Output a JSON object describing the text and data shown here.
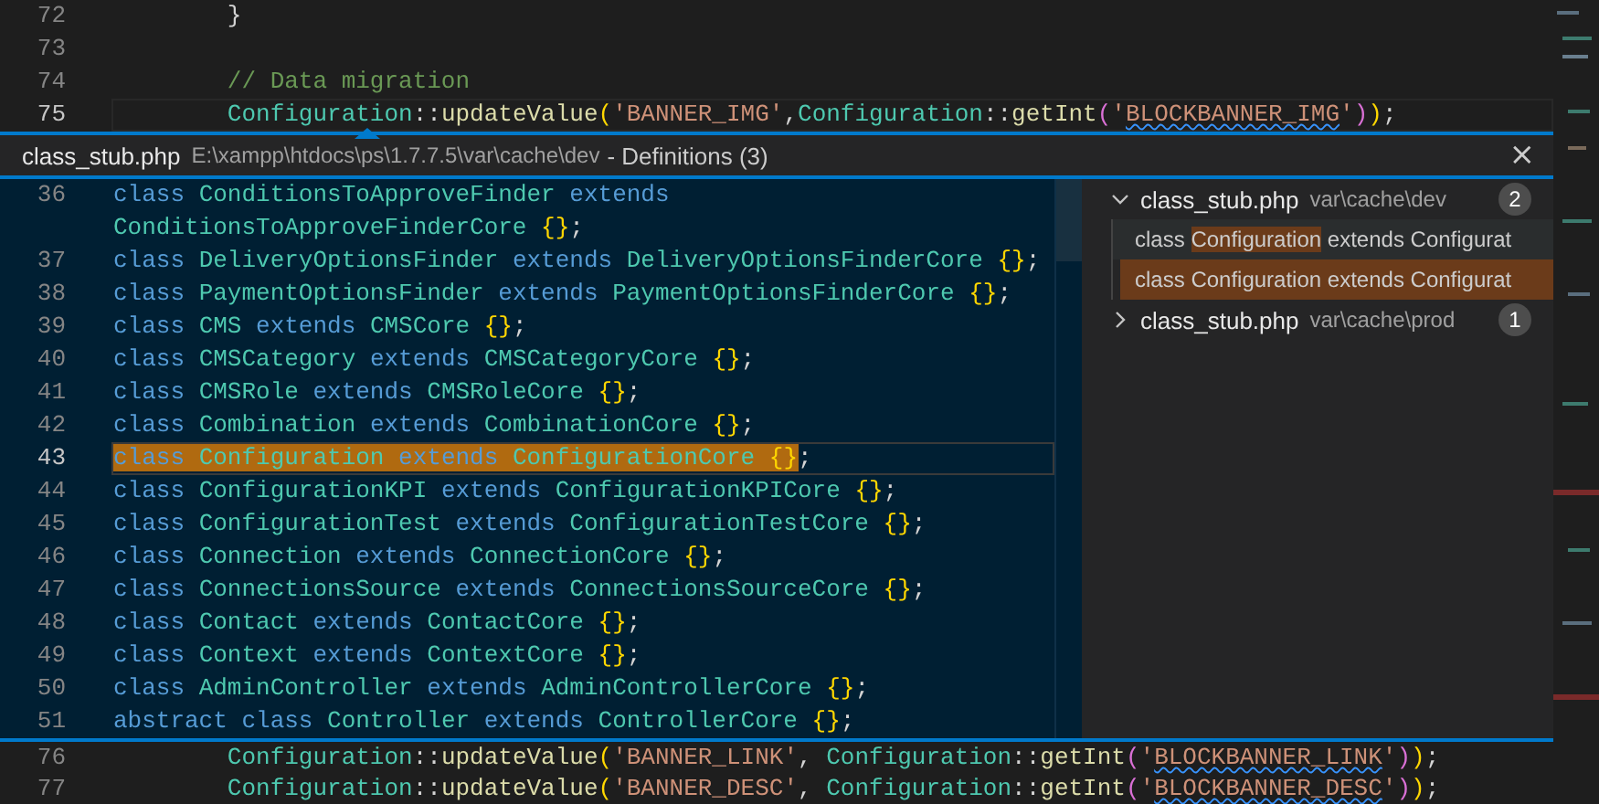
{
  "editor_top": {
    "lines": [
      {
        "num": "72",
        "current": false,
        "tokens": [
          {
            "t": "        }",
            "kind": "punct"
          }
        ]
      },
      {
        "num": "73",
        "current": false
      },
      {
        "num": "74",
        "current": false,
        "tokens": [
          {
            "t": "        // Data migration",
            "kind": "comment"
          }
        ]
      },
      {
        "num": "75",
        "current": true,
        "tokens": [
          {
            "t": "        Configuration",
            "kind": "cls"
          },
          {
            "t": "::",
            "kind": "punct"
          },
          {
            "t": "updateValue",
            "kind": "func"
          },
          {
            "t": "(",
            "kind": "brace"
          },
          {
            "t": "'BANNER_IMG'",
            "kind": "str"
          },
          {
            "t": ",",
            "kind": "punct"
          },
          {
            "t": "Configuration",
            "kind": "cls"
          },
          {
            "t": "::",
            "kind": "punct"
          },
          {
            "t": "getInt",
            "kind": "func"
          },
          {
            "t": "(",
            "kind": "brace2"
          },
          {
            "t": "'",
            "kind": "str"
          },
          {
            "t": "BLOCKBANNER_IMG",
            "kind": "strwarn"
          },
          {
            "t": "'",
            "kind": "str"
          },
          {
            "t": ")",
            "kind": "brace2"
          },
          {
            "t": ")",
            "kind": "brace"
          },
          {
            "t": ";",
            "kind": "punct"
          }
        ]
      }
    ]
  },
  "peek": {
    "file": "class_stub.php",
    "path": "E:\\xampp\\htdocs\\ps\\1.7.7.5\\var\\cache\\dev",
    "title": "- Definitions (3)",
    "close": "×",
    "code_lines": [
      {
        "num": "36",
        "current": false,
        "tokens": [
          {
            "t": "class ",
            "kind": "kw"
          },
          {
            "t": "ConditionsToApproveFinder",
            "kind": "cls"
          },
          {
            "t": " extends",
            "kind": "kw"
          }
        ]
      },
      {
        "current": false,
        "tokens": [
          {
            "t": "ConditionsToApproveFinderCore ",
            "kind": "cls"
          },
          {
            "t": "{}",
            "kind": "brace"
          },
          {
            "t": ";",
            "kind": "punct"
          }
        ]
      },
      {
        "num": "37",
        "current": false,
        "tokens": [
          {
            "t": "class ",
            "kind": "kw"
          },
          {
            "t": "DeliveryOptionsFinder",
            "kind": "cls"
          },
          {
            "t": " extends ",
            "kind": "kw"
          },
          {
            "t": "DeliveryOptionsFinderCore ",
            "kind": "cls"
          },
          {
            "t": "{}",
            "kind": "brace"
          },
          {
            "t": ";",
            "kind": "punct"
          }
        ]
      },
      {
        "num": "38",
        "current": false,
        "tokens": [
          {
            "t": "class ",
            "kind": "kw"
          },
          {
            "t": "PaymentOptionsFinder",
            "kind": "cls"
          },
          {
            "t": " extends ",
            "kind": "kw"
          },
          {
            "t": "PaymentOptionsFinderCore ",
            "kind": "cls"
          },
          {
            "t": "{}",
            "kind": "brace"
          },
          {
            "t": ";",
            "kind": "punct"
          }
        ]
      },
      {
        "num": "39",
        "current": false,
        "tokens": [
          {
            "t": "class ",
            "kind": "kw"
          },
          {
            "t": "CMS",
            "kind": "cls"
          },
          {
            "t": " extends ",
            "kind": "kw"
          },
          {
            "t": "CMSCore ",
            "kind": "cls"
          },
          {
            "t": "{}",
            "kind": "brace"
          },
          {
            "t": ";",
            "kind": "punct"
          }
        ]
      },
      {
        "num": "40",
        "current": false,
        "tokens": [
          {
            "t": "class ",
            "kind": "kw"
          },
          {
            "t": "CMSCategory",
            "kind": "cls"
          },
          {
            "t": " extends ",
            "kind": "kw"
          },
          {
            "t": "CMSCategoryCore ",
            "kind": "cls"
          },
          {
            "t": "{}",
            "kind": "brace"
          },
          {
            "t": ";",
            "kind": "punct"
          }
        ]
      },
      {
        "num": "41",
        "current": false,
        "tokens": [
          {
            "t": "class ",
            "kind": "kw"
          },
          {
            "t": "CMSRole",
            "kind": "cls"
          },
          {
            "t": " extends ",
            "kind": "kw"
          },
          {
            "t": "CMSRoleCore ",
            "kind": "cls"
          },
          {
            "t": "{}",
            "kind": "brace"
          },
          {
            "t": ";",
            "kind": "punct"
          }
        ]
      },
      {
        "num": "42",
        "current": false,
        "tokens": [
          {
            "t": "class ",
            "kind": "kw"
          },
          {
            "t": "Combination",
            "kind": "cls"
          },
          {
            "t": " extends ",
            "kind": "kw"
          },
          {
            "t": "CombinationCore ",
            "kind": "cls"
          },
          {
            "t": "{}",
            "kind": "brace"
          },
          {
            "t": ";",
            "kind": "punct"
          }
        ]
      },
      {
        "num": "43",
        "current": true,
        "tokens": [
          {
            "t": "class ",
            "kind": "kw",
            "hl": true
          },
          {
            "t": "Configuration",
            "kind": "cls",
            "hl": true
          },
          {
            "t": " extends ",
            "kind": "kw",
            "hl": true
          },
          {
            "t": "ConfigurationCore ",
            "kind": "cls",
            "hl": true
          },
          {
            "t": "{}",
            "kind": "brace",
            "hl": true
          },
          {
            "t": ";",
            "kind": "punct",
            "hl": false
          }
        ]
      },
      {
        "num": "44",
        "current": false,
        "tokens": [
          {
            "t": "class ",
            "kind": "kw"
          },
          {
            "t": "ConfigurationKPI",
            "kind": "cls"
          },
          {
            "t": " extends ",
            "kind": "kw"
          },
          {
            "t": "ConfigurationKPICore ",
            "kind": "cls"
          },
          {
            "t": "{}",
            "kind": "brace"
          },
          {
            "t": ";",
            "kind": "punct"
          }
        ]
      },
      {
        "num": "45",
        "current": false,
        "tokens": [
          {
            "t": "class ",
            "kind": "kw"
          },
          {
            "t": "ConfigurationTest",
            "kind": "cls"
          },
          {
            "t": " extends ",
            "kind": "kw"
          },
          {
            "t": "ConfigurationTestCore ",
            "kind": "cls"
          },
          {
            "t": "{}",
            "kind": "brace"
          },
          {
            "t": ";",
            "kind": "punct"
          }
        ]
      },
      {
        "num": "46",
        "current": false,
        "tokens": [
          {
            "t": "class ",
            "kind": "kw"
          },
          {
            "t": "Connection",
            "kind": "cls"
          },
          {
            "t": " extends ",
            "kind": "kw"
          },
          {
            "t": "ConnectionCore ",
            "kind": "cls"
          },
          {
            "t": "{}",
            "kind": "brace"
          },
          {
            "t": ";",
            "kind": "punct"
          }
        ]
      },
      {
        "num": "47",
        "current": false,
        "tokens": [
          {
            "t": "class ",
            "kind": "kw"
          },
          {
            "t": "ConnectionsSource",
            "kind": "cls"
          },
          {
            "t": " extends ",
            "kind": "kw"
          },
          {
            "t": "ConnectionsSourceCore ",
            "kind": "cls"
          },
          {
            "t": "{}",
            "kind": "brace"
          },
          {
            "t": ";",
            "kind": "punct"
          }
        ]
      },
      {
        "num": "48",
        "current": false,
        "tokens": [
          {
            "t": "class ",
            "kind": "kw"
          },
          {
            "t": "Contact",
            "kind": "cls"
          },
          {
            "t": " extends ",
            "kind": "kw"
          },
          {
            "t": "ContactCore ",
            "kind": "cls"
          },
          {
            "t": "{}",
            "kind": "brace"
          },
          {
            "t": ";",
            "kind": "punct"
          }
        ]
      },
      {
        "num": "49",
        "current": false,
        "tokens": [
          {
            "t": "class ",
            "kind": "kw"
          },
          {
            "t": "Context",
            "kind": "cls"
          },
          {
            "t": " extends ",
            "kind": "kw"
          },
          {
            "t": "ContextCore ",
            "kind": "cls"
          },
          {
            "t": "{}",
            "kind": "brace"
          },
          {
            "t": ";",
            "kind": "punct"
          }
        ]
      },
      {
        "num": "50",
        "current": false,
        "tokens": [
          {
            "t": "class ",
            "kind": "kw"
          },
          {
            "t": "AdminController",
            "kind": "cls"
          },
          {
            "t": " extends ",
            "kind": "kw"
          },
          {
            "t": "AdminControllerCore ",
            "kind": "cls"
          },
          {
            "t": "{}",
            "kind": "brace"
          },
          {
            "t": ";",
            "kind": "punct"
          }
        ]
      },
      {
        "num": "51",
        "current": false,
        "tokens": [
          {
            "t": "abstract class ",
            "kind": "kw"
          },
          {
            "t": "Controller",
            "kind": "cls"
          },
          {
            "t": " extends ",
            "kind": "kw"
          },
          {
            "t": "ControllerCore ",
            "kind": "cls"
          },
          {
            "t": "{}",
            "kind": "brace"
          },
          {
            "t": ";",
            "kind": "punct"
          }
        ]
      }
    ],
    "references": [
      {
        "file": "class_stub.php",
        "path": "var\\cache\\dev",
        "count": "2",
        "expanded": true,
        "children": [
          {
            "before": "class ",
            "match": "Configuration",
            "after": " extends Configurat",
            "selected": false
          },
          {
            "before": "class ",
            "match": "Configuration",
            "after": " extends Configurat",
            "selected": true
          }
        ]
      },
      {
        "file": "class_stub.php",
        "path": "var\\cache\\prod",
        "count": "1",
        "expanded": false
      }
    ]
  },
  "editor_bottom": {
    "lines": [
      {
        "num": "76",
        "current": false,
        "tokens": [
          {
            "t": "        Configuration",
            "kind": "cls"
          },
          {
            "t": "::",
            "kind": "punct"
          },
          {
            "t": "updateValue",
            "kind": "func"
          },
          {
            "t": "(",
            "kind": "brace"
          },
          {
            "t": "'BANNER_LINK'",
            "kind": "str"
          },
          {
            "t": ", ",
            "kind": "punct"
          },
          {
            "t": "Configuration",
            "kind": "cls"
          },
          {
            "t": "::",
            "kind": "punct"
          },
          {
            "t": "getInt",
            "kind": "func"
          },
          {
            "t": "(",
            "kind": "brace2"
          },
          {
            "t": "'",
            "kind": "str"
          },
          {
            "t": "BLOCKBANNER_LINK",
            "kind": "strwarn"
          },
          {
            "t": "'",
            "kind": "str"
          },
          {
            "t": ")",
            "kind": "brace2"
          },
          {
            "t": ")",
            "kind": "brace"
          },
          {
            "t": ";",
            "kind": "punct"
          }
        ]
      },
      {
        "num": "77",
        "current": false,
        "tokens": [
          {
            "t": "        Configuration",
            "kind": "cls"
          },
          {
            "t": "::",
            "kind": "punct"
          },
          {
            "t": "updateValue",
            "kind": "func"
          },
          {
            "t": "(",
            "kind": "brace"
          },
          {
            "t": "'BANNER_DESC'",
            "kind": "str"
          },
          {
            "t": ", ",
            "kind": "punct"
          },
          {
            "t": "Configuration",
            "kind": "cls"
          },
          {
            "t": "::",
            "kind": "punct"
          },
          {
            "t": "getInt",
            "kind": "func"
          },
          {
            "t": "(",
            "kind": "brace2"
          },
          {
            "t": "'",
            "kind": "str"
          },
          {
            "t": "BLOCKBANNER_DESC",
            "kind": "strwarn"
          },
          {
            "t": "'",
            "kind": "str"
          },
          {
            "t": ")",
            "kind": "brace2"
          },
          {
            "t": ")",
            "kind": "brace"
          },
          {
            "t": ";",
            "kind": "punct"
          }
        ]
      }
    ]
  }
}
